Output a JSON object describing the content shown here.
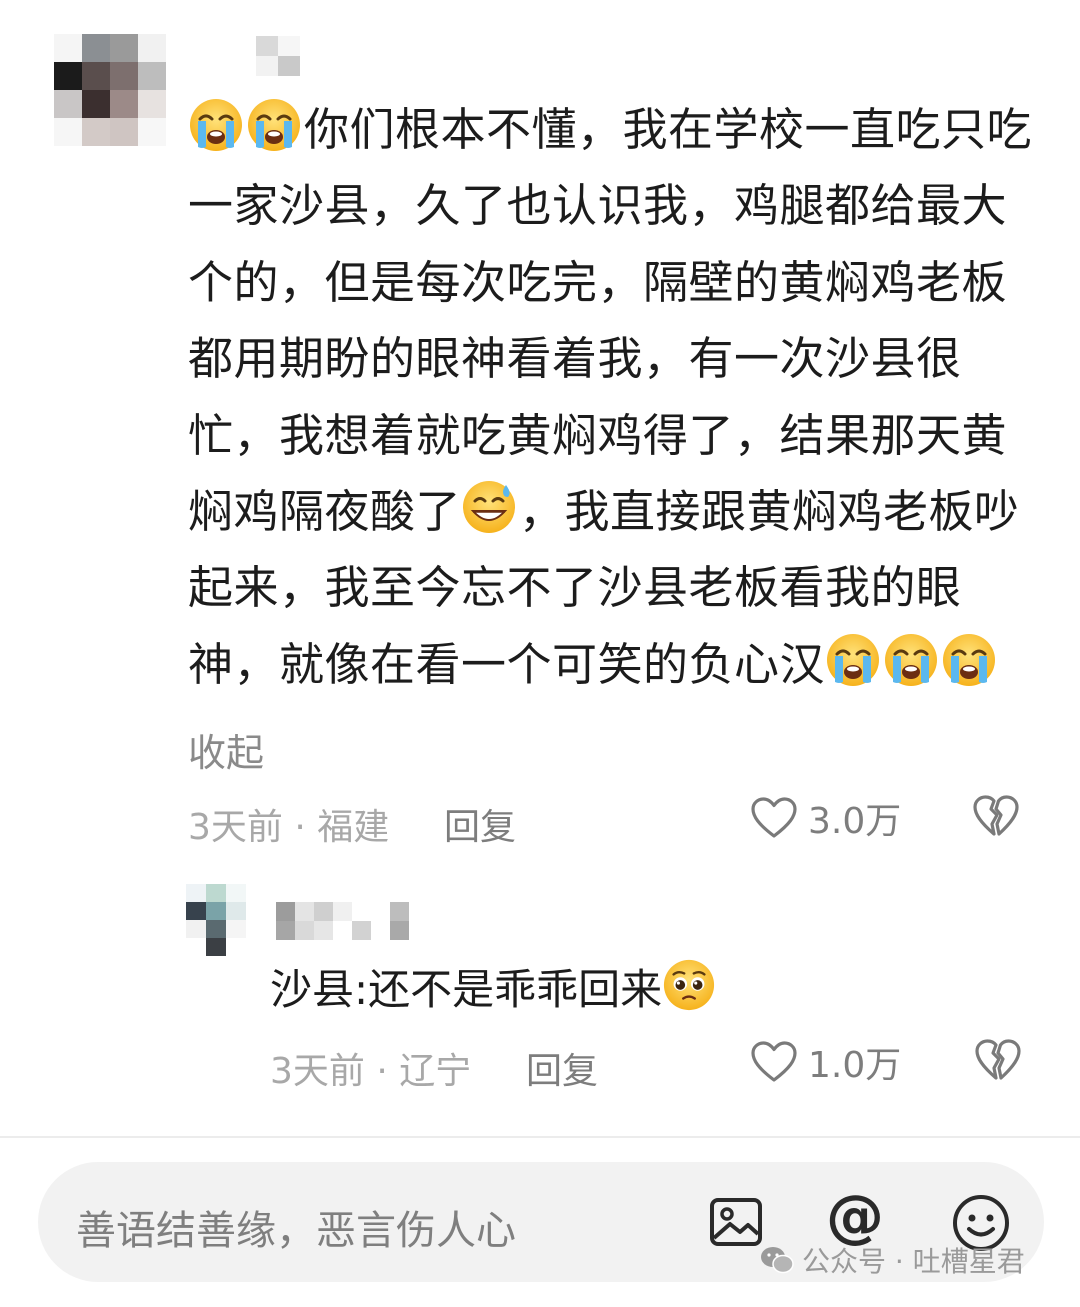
{
  "comment": {
    "lines": [
      "你们根本不懂，我在学校一直吃只吃",
      "一家沙县，久了也认识我，鸡腿都给最大",
      "个的，但是每次吃完，隔壁的黄焖鸡老板",
      "都用期盼的眼神看着我，有一次沙县很",
      "忙，我想着就吃黄焖鸡得了，结果那天黄",
      "焖鸡隔夜酸了",
      "，我直接跟黄焖鸡老板吵",
      "起来，我至今忘不了沙县老板看我的眼",
      "神，就像在看一个可笑的负心汉"
    ],
    "collapse_label": "收起",
    "time_location": "3天前 · 福建",
    "reply_label": "回复",
    "like_count": "3.0万"
  },
  "reply": {
    "text": "沙县:还不是乖乖回来",
    "time_location": "3天前 · 辽宁",
    "reply_label": "回复",
    "like_count": "1.0万"
  },
  "input": {
    "placeholder": "善语结善缘，恶言伤人心",
    "at_symbol": "@"
  },
  "watermark": {
    "text": "公众号 · 吐槽星君"
  },
  "icons": {
    "emoji_cry": "loudly-crying-face",
    "emoji_sweat": "grinning-face-with-sweat",
    "emoji_pleading": "pleading-face",
    "like": "heart-outline-icon",
    "dislike": "broken-heart-outline-icon",
    "image": "image-icon",
    "emoji_picker": "smiley-icon"
  },
  "colors": {
    "text": "#1c1c1c",
    "meta": "#a8a8a8",
    "input_bg": "#f2f2f2"
  }
}
